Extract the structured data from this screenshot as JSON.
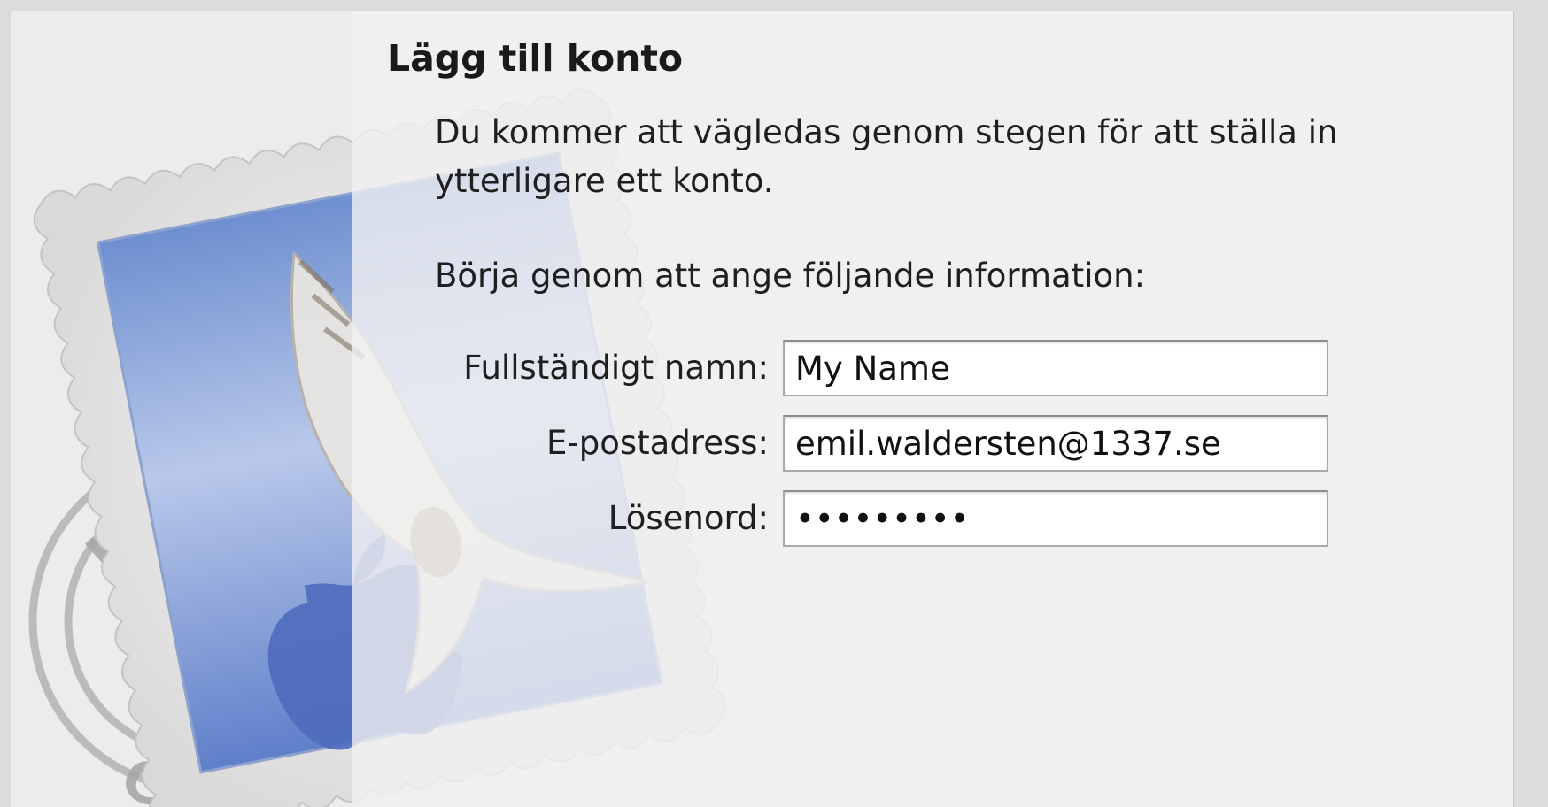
{
  "dialog": {
    "title": "Lägg till konto",
    "intro_line1": "Du kommer att vägledas genom stegen för att ställa in",
    "intro_line2": "ytterligare ett konto.",
    "prompt": "Börja genom att ange följande information:"
  },
  "form": {
    "full_name": {
      "label": "Fullständigt namn:",
      "value": "My Name"
    },
    "email": {
      "label": "E-postadress:",
      "value": "emil.waldersten@1337.se"
    },
    "password": {
      "label": "Lösenord:",
      "value": "•••••••••"
    }
  },
  "icons": {
    "mail_stamp": "mail-stamp-icon"
  }
}
